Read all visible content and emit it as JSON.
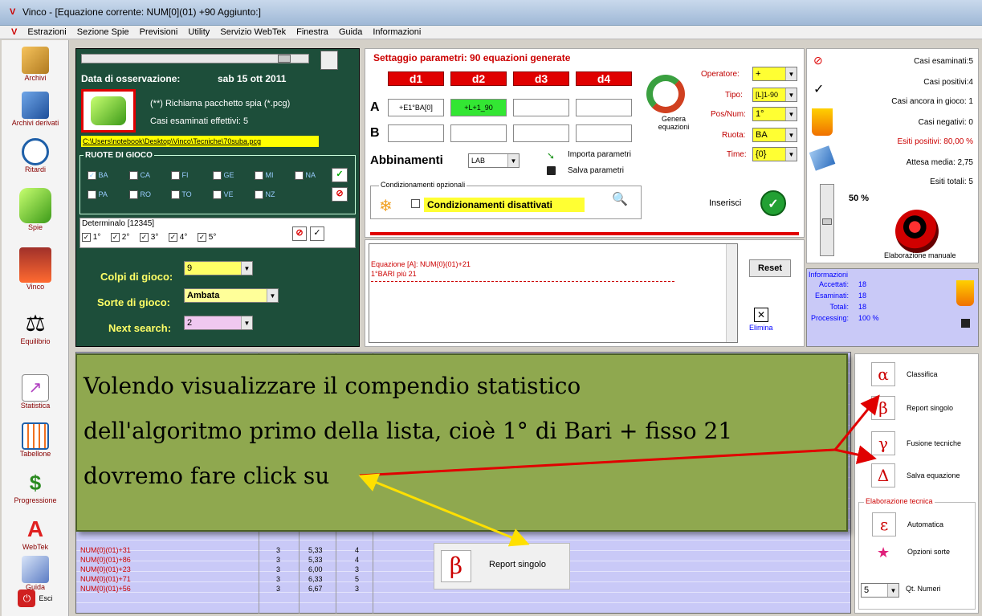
{
  "window": {
    "title": "Vinco - [Equazione corrente: NUM[0](01) +90 Aggiunto:]"
  },
  "menu": [
    "Estrazioni",
    "Sezione Spie",
    "Previsioni",
    "Utility",
    "Servizio WebTek",
    "Finestra",
    "Guida",
    "Informazioni"
  ],
  "sidebar": [
    "Archivi",
    "Archivi derivati",
    "Ritardi",
    "Spie",
    "Vinco",
    "Equilibrio",
    "Statistica",
    "Tabellone",
    "Progressione",
    "WebTek",
    "Guida",
    "Esci"
  ],
  "left_panel": {
    "date_label": "Data di osservazione:",
    "date_value": "sab 15 ott 2011",
    "pcg_text": "(**) Richiama pacchetto spia (*.pcg)",
    "casi_text": "Casi esaminati effettivi: 5",
    "path": "C:\\Users\\notebook\\Desktop\\Vinco\\Tecniche\\70suba.pcg",
    "ruote_title": "RUOTE DI GIOCO",
    "ruote": [
      "BA",
      "CA",
      "FI",
      "GE",
      "MI",
      "NA",
      "PA",
      "RO",
      "TO",
      "VE",
      "NZ"
    ],
    "determinato_title": "Determinalo [12345]",
    "determinato": [
      "1°",
      "2°",
      "3°",
      "4°",
      "5°"
    ],
    "colpi_label": "Colpi di gioco:",
    "colpi_value": "9",
    "sorte_label": "Sorte di gioco:",
    "sorte_value": "Ambata",
    "next_label": "Next search:",
    "next_value": "2"
  },
  "settings": {
    "title": "Settaggio parametri: 90 equazioni generate",
    "d_headers": [
      "d1",
      "d2",
      "d3",
      "d4"
    ],
    "row_a": "A",
    "row_b": "B",
    "a_cells": [
      "+E1°BA[0]",
      "+L+1_90",
      "",
      ""
    ],
    "genera": "Genera equazioni",
    "operatore_label": "Operatore:",
    "operatore_value": "+",
    "tipo_label": "Tipo:",
    "tipo_value": "[L]1-90",
    "posnum_label": "Pos/Num:",
    "posnum_value": "1°",
    "ruota_label": "Ruota:",
    "ruota_value": "BA",
    "time_label": "Time:",
    "time_value": "{0}",
    "abbinamenti_label": "Abbinamenti",
    "abbinamenti_value": "LAB",
    "importa": "Importa parametri",
    "salva": "Salva parametri",
    "cond_title": "Condizionamenti opzionali",
    "cond_text": "Condizionamenti disattivati",
    "inserisci": "Inserisci"
  },
  "equation_box": {
    "line1": "Equazione [A]: NUM{0}(01)+21",
    "line2": "1°BARI  più 21",
    "reset": "Reset",
    "elimina": "Elimina"
  },
  "stats": {
    "casi_esaminati": "Casi esaminati:5",
    "casi_positivi": "Casi positivi:4",
    "casi_in_gioco": "Casi ancora in gioco: 1",
    "casi_negativi": "Casi negativi: 0",
    "esiti_positivi": "Esiti positivi: 80,00 %",
    "attesa": "Attesa media: 2,75",
    "esiti_totali": "Esiti totali: 5",
    "percent": "50 %",
    "elab_manuale": "Elaborazione manuale"
  },
  "info": {
    "title": "Informazioni",
    "rows": [
      {
        "label": "Accettati:",
        "value": "18"
      },
      {
        "label": "Esaminati:",
        "value": "18"
      },
      {
        "label": "Totali:",
        "value": "18"
      },
      {
        "label": "Processing:",
        "value": "100 %"
      }
    ]
  },
  "right_buttons": [
    {
      "symbol": "α",
      "label": "Classifica"
    },
    {
      "symbol": "β",
      "label": "Report singolo"
    },
    {
      "symbol": "γ",
      "label": "Fusione tecniche"
    },
    {
      "symbol": "Δ",
      "label": "Salva equazione"
    }
  ],
  "elab_tecnica": {
    "title": "Elaborazione tecnica",
    "automatica": "Automatica",
    "opzioni": "Opzioni sorte",
    "qt_value": "5",
    "qt_label": "Qt. Numeri"
  },
  "overlay": {
    "line1": "Volendo visualizzare il compendio statistico",
    "line2": "dell'algoritmo primo della lista, cioè 1° di Bari + fisso 21",
    "line3": "dovremo fare click su"
  },
  "callout": {
    "symbol": "β",
    "label": "Report singolo"
  },
  "table_rows": [
    [
      "NUM{0}(01)+31",
      "3",
      "5,33",
      "4"
    ],
    [
      "NUM{0}(01)+86",
      "3",
      "5,33",
      "4"
    ],
    [
      "NUM{0}(01)+23",
      "3",
      "6,00",
      "3"
    ],
    [
      "NUM{0}(01)+71",
      "3",
      "6,33",
      "5"
    ],
    [
      "NUM{0}(01)+56",
      "3",
      "6,67",
      "3"
    ]
  ],
  "colors": {
    "green_panel": "#1d4e3a",
    "overlay": "#8fa84f",
    "accent_red": "#e00000",
    "yellow": "#ffff66"
  }
}
